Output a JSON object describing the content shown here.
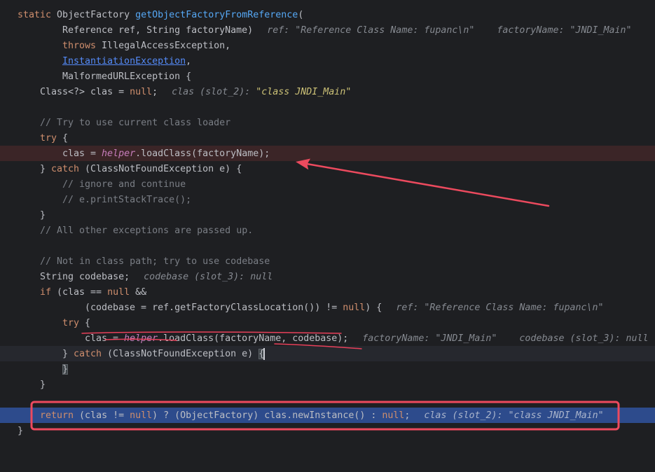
{
  "colors": {
    "editor_background": "#1E1F22",
    "text": "#BCBEC4",
    "keyword": "#CF8E6D",
    "method_declaration": "#56A8F5",
    "comment": "#7A7E85",
    "field": "#C77DBB",
    "link": "#548AF7",
    "inline_value": "#868A91",
    "changed_value": "#CDC277",
    "error_line": "#3B2527",
    "caret_line": "#26282E",
    "execution_line": "#2D4B8C",
    "annotation": "#EC4A5E"
  },
  "lines": [
    {
      "tokens": [
        "static",
        " ObjectFactory ",
        "getObjectFactoryFromReference",
        "("
      ]
    },
    {
      "tokens": [
        "Reference ref, String factoryName)"
      ],
      "hints": [
        "ref: \"Reference Class Name: fupanc\\n\"",
        "factoryName: \"JNDI_Main\""
      ]
    },
    {
      "tokens": [
        "throws",
        " IllegalAccessException,"
      ]
    },
    {
      "tokens": [
        "InstantiationException",
        ","
      ]
    },
    {
      "tokens": [
        "MalformedURLException {"
      ]
    },
    {
      "tokens": [
        "Class<?> clas = ",
        "null",
        ";"
      ],
      "hints": [
        "clas (slot_2): ",
        "\"class JNDI_Main\""
      ]
    },
    {
      "tokens": []
    },
    {
      "tokens": [
        "// Try to use current class loader"
      ]
    },
    {
      "tokens": [
        "try",
        " {"
      ]
    },
    {
      "tokens": [
        "clas = ",
        "helper",
        ".loadClass(factoryName);"
      ]
    },
    {
      "tokens": [
        "} ",
        "catch",
        " (ClassNotFoundException e) {"
      ]
    },
    {
      "tokens": [
        "// ignore and continue"
      ]
    },
    {
      "tokens": [
        "// e.printStackTrace();"
      ]
    },
    {
      "tokens": [
        "}"
      ]
    },
    {
      "tokens": [
        "// All other exceptions are passed up."
      ]
    },
    {
      "tokens": []
    },
    {
      "tokens": [
        "// Not in class path; try to use codebase"
      ]
    },
    {
      "tokens": [
        "String codebase;"
      ],
      "hints": [
        "codebase (slot_3): null"
      ]
    },
    {
      "tokens": [
        "if",
        " (clas == ",
        "null",
        " &&"
      ]
    },
    {
      "tokens": [
        "(codebase = ref.getFactoryClassLocation()) != ",
        "null",
        ") {"
      ],
      "hints": [
        "ref: \"Reference Class Name: fupanc\\n\""
      ]
    },
    {
      "tokens": [
        "try",
        " {"
      ]
    },
    {
      "tokens": [
        "clas = ",
        "helper",
        ".loadClass(factoryName, codebase);"
      ],
      "hints": [
        "factoryName: \"JNDI_Main\"",
        "codebase (slot_3): null"
      ]
    },
    {
      "tokens": [
        "} ",
        "catch",
        " (ClassNotFoundException e) ",
        "{"
      ]
    },
    {
      "tokens": [
        "}"
      ]
    },
    {
      "tokens": [
        "}"
      ]
    },
    {
      "tokens": []
    },
    {
      "tokens": [
        "return",
        " (clas != ",
        "null",
        ") ? (ObjectFactory) clas.newInstance() : ",
        "null",
        ";"
      ],
      "hints": [
        "clas (slot_2): ",
        "\"class JNDI_Main\""
      ]
    },
    {
      "tokens": [
        "}"
      ]
    }
  ]
}
